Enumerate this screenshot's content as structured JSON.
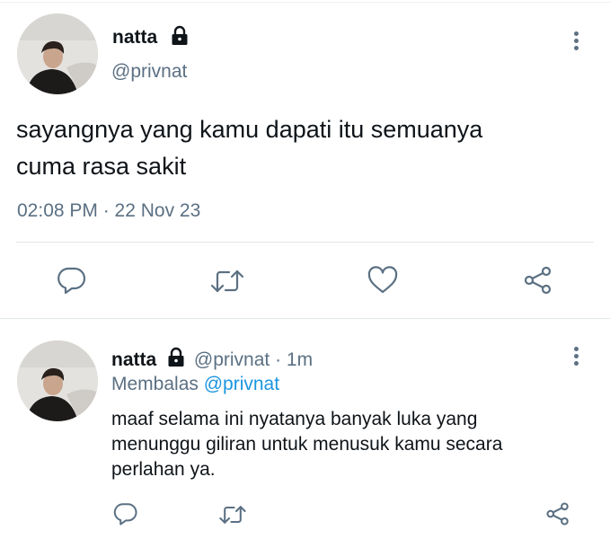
{
  "tweet": {
    "author_name": "natta",
    "author_handle": "@privnat",
    "text_line1": "sayangnya yang kamu dapati itu semuanya",
    "text_line2": "cuma rasa sakit",
    "timestamp": "02:08 PM · 22 Nov 23",
    "icons": [
      "lock-icon",
      "more-vertical-icon",
      "reply-icon",
      "retweet-icon",
      "like-icon",
      "share-icon"
    ]
  },
  "reply": {
    "author_name": "natta",
    "author_handle": "@privnat",
    "separator": "·",
    "time_ago": "1m",
    "replying_to_label": "Membalas",
    "replying_to_handle": "@privnat",
    "text_line1": "maaf selama ini nyatanya banyak luka yang",
    "text_line2": "menunggu giliran untuk menusuk kamu secara",
    "text_line3": "perlahan ya.",
    "icons": [
      "lock-icon",
      "more-vertical-icon",
      "reply-icon",
      "retweet-icon",
      "share-icon"
    ]
  },
  "colors": {
    "text": "#0f1419",
    "secondary": "#5b7083",
    "link": "#1b95e0",
    "divider": "#e1e6ea"
  }
}
